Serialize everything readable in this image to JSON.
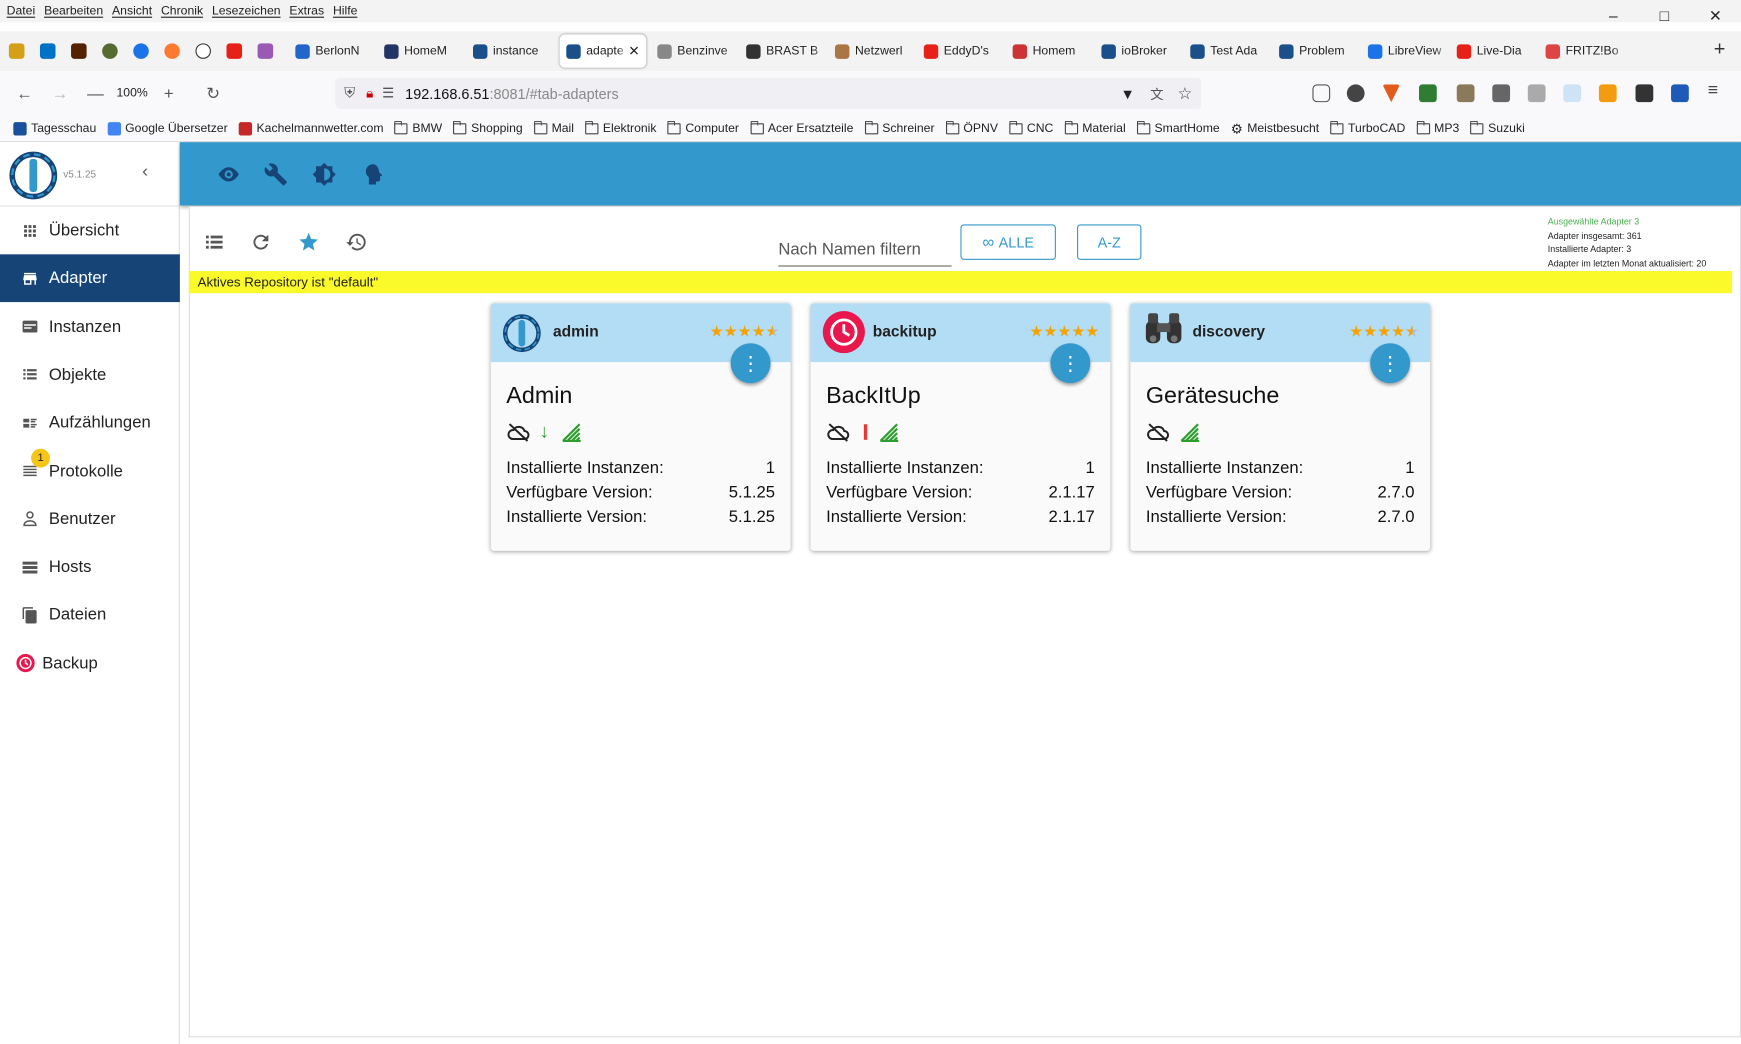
{
  "browser": {
    "menu": [
      "Datei",
      "Bearbeiten",
      "Ansicht",
      "Chronik",
      "Lesezeichen",
      "Extras",
      "Hilfe"
    ],
    "tabs": [
      {
        "label": "BerlonN",
        "color": "#2266cc"
      },
      {
        "label": "HomeM",
        "color": "#223366"
      },
      {
        "label": "instance",
        "color": "#1b4f8a"
      },
      {
        "label": "adapte",
        "color": "#1b4f8a",
        "active": true
      },
      {
        "label": "Benzinve",
        "color": "#888888"
      },
      {
        "label": "BRAST B",
        "color": "#333333"
      },
      {
        "label": "Netzwerl",
        "color": "#aa7744"
      },
      {
        "label": "EddyD's",
        "color": "#e62117"
      },
      {
        "label": "Homem",
        "color": "#cc3333"
      },
      {
        "label": "ioBroker",
        "color": "#1b4f8a"
      },
      {
        "label": "Test Ada",
        "color": "#1b4f8a"
      },
      {
        "label": "Problem",
        "color": "#1b4f8a"
      },
      {
        "label": "LibreView",
        "color": "#1a73e8"
      },
      {
        "label": "Live-Dia",
        "color": "#e62117"
      },
      {
        "label": "FRITZ!Bo",
        "color": "#d44"
      }
    ],
    "new_tab": "+",
    "zoom": "100%",
    "url_host": "192.168.6.51",
    "url_path": ":8081/#tab-adapters",
    "bookmarks": [
      {
        "label": "Tagesschau",
        "icon": "tagesschau-icon",
        "color": "#1a4f9c"
      },
      {
        "label": "Google Übersetzer",
        "icon": "google-translate-icon",
        "color": "#4285f4"
      },
      {
        "label": "Kachelmannwetter.com",
        "icon": "kachelmann-icon",
        "color": "#c62828"
      },
      {
        "label": "BMW",
        "icon": "folder-icon"
      },
      {
        "label": "Shopping",
        "icon": "folder-icon"
      },
      {
        "label": "Mail",
        "icon": "folder-icon"
      },
      {
        "label": "Elektronik",
        "icon": "folder-icon"
      },
      {
        "label": "Computer",
        "icon": "folder-icon"
      },
      {
        "label": "Acer Ersatzteile",
        "icon": "folder-icon"
      },
      {
        "label": "Schreiner",
        "icon": "folder-icon"
      },
      {
        "label": "ÖPNV",
        "icon": "folder-icon"
      },
      {
        "label": "CNC",
        "icon": "folder-icon"
      },
      {
        "label": "Material",
        "icon": "folder-icon"
      },
      {
        "label": "SmartHome",
        "icon": "folder-icon"
      },
      {
        "label": "Meistbesucht",
        "icon": "gear-icon"
      },
      {
        "label": "TurboCAD",
        "icon": "folder-icon"
      },
      {
        "label": "MP3",
        "icon": "folder-icon"
      },
      {
        "label": "Suzuki",
        "icon": "folder-icon"
      }
    ]
  },
  "app": {
    "version": "v5.1.25",
    "nav": [
      {
        "label": "Übersicht",
        "icon": "apps-icon"
      },
      {
        "label": "Adapter",
        "icon": "store-icon",
        "active": true
      },
      {
        "label": "Instanzen",
        "icon": "instances-icon"
      },
      {
        "label": "Objekte",
        "icon": "list-icon"
      },
      {
        "label": "Aufzählungen",
        "icon": "enums-icon"
      },
      {
        "label": "Protokolle",
        "icon": "logs-icon",
        "badge": "1"
      },
      {
        "label": "Benutzer",
        "icon": "user-icon"
      },
      {
        "label": "Hosts",
        "icon": "hosts-icon"
      },
      {
        "label": "Dateien",
        "icon": "files-icon"
      },
      {
        "label": "Backup",
        "icon": "backup-icon"
      }
    ],
    "filter_placeholder": "Nach Namen filtern",
    "btn_all": "ALLE",
    "btn_az": "A-Z",
    "stats": {
      "selected": "Ausgewählte Adapter 3",
      "total": "Adapter insgesamt: 361",
      "installed": "Installierte Adapter: 3",
      "updated": "Adapter im letzten Monat aktualisiert: 20"
    },
    "repo_notice": "Aktives Repository ist \"default\"",
    "labels": {
      "instances": "Installierte Instanzen:",
      "available": "Verfügbare Version:",
      "installed": "Installierte Version:"
    },
    "cards": [
      {
        "name": "admin",
        "title": "Admin",
        "rating": 4.5,
        "stars": "★★★★★",
        "instances": "1",
        "available": "5.1.25",
        "installed": "5.1.25",
        "icon": "admin-icon",
        "status": "update-arrow"
      },
      {
        "name": "backitup",
        "title": "BackItUp",
        "rating": 5,
        "stars": "★★★★★",
        "instances": "1",
        "available": "2.1.17",
        "installed": "2.1.17",
        "icon": "backitup-icon",
        "status": "warning-bar"
      },
      {
        "name": "discovery",
        "title": "Gerätesuche",
        "rating": 4.5,
        "stars": "★★★★★",
        "instances": "1",
        "available": "2.7.0",
        "installed": "2.7.0",
        "icon": "discovery-icon",
        "status": "none"
      }
    ]
  }
}
